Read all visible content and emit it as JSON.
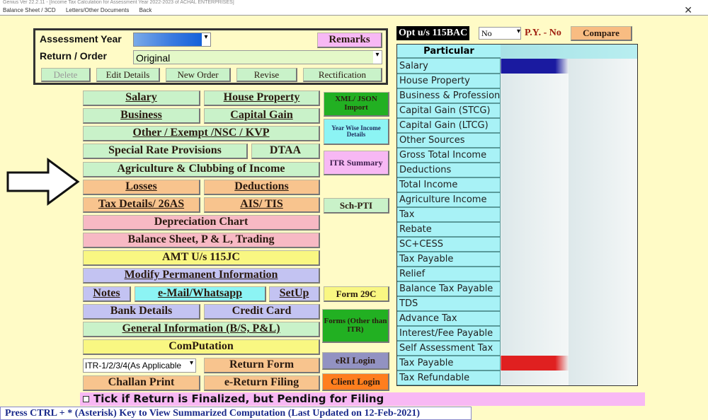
{
  "window": {
    "title": "Genius Ver 22.2.11 - [Income Tax Calculation for Assessment Year 2022-2023 of ACHAL ENTERPRISES]",
    "close": "✕"
  },
  "menu": [
    "Balance Sheet / 3CD",
    "Letters/Other Documents",
    "Back"
  ],
  "panel": {
    "assessment_year_label": "Assessment Year",
    "return_order_label": "Return / Order",
    "return_order_value": "Original",
    "remarks": "Remarks",
    "actions": [
      "Delete",
      "Edit Details",
      "New Order",
      "Revise",
      "Rectification"
    ]
  },
  "opt": {
    "label": "Opt u/s 115BAC",
    "value": "No",
    "py": "P.Y. - No",
    "compare": "Compare"
  },
  "buttons": {
    "salary": "Salary",
    "house_property": "House Property",
    "business": "Business",
    "capital_gain": "Capital Gain",
    "other": "Other / Exempt /NSC / KVP",
    "special_rate": "Special Rate Provisions",
    "dtaa": "DTAA",
    "agriculture": "Agriculture & Clubbing of Income",
    "losses": "Losses",
    "deductions": "Deductions",
    "tax_details": "Tax Details/ 26AS",
    "ais": "AIS/ TIS",
    "depreciation": "Depreciation Chart",
    "balance_sheet": "Balance Sheet, P & L, Trading",
    "amt": "AMT U/s 115JC",
    "modify": "Modify Permanent Information",
    "notes": "Notes",
    "email": "e-Mail/Whatsapp",
    "setup": "SetUp",
    "bank": "Bank Details",
    "credit_card": "Credit Card",
    "general": "General Information (B/S, P&L)",
    "computation": "ComPutation",
    "itr_select": "ITR-1/2/3/4(As Applicable",
    "return_form": "Return Form",
    "challan": "Challan Print",
    "e_return": "e-Return Filing"
  },
  "side": {
    "xml": "XML/ JSON Import",
    "year_wise": "Year Wise Income Details",
    "itr_summary": "ITR Summary",
    "sch_pti": "Sch-PTI",
    "form29c": "Form 29C",
    "forms_other": "Forms (Other than ITR)",
    "eri": "eRI Login",
    "client": "Client Login"
  },
  "table": {
    "header": "Particular",
    "rows": [
      "Salary",
      "House Property",
      "Business & Profession",
      "Capital Gain (STCG)",
      "Capital Gain (LTCG)",
      "Other Sources",
      "Gross Total Income",
      "Deductions",
      "Total Income",
      "Agriculture Income",
      "Tax",
      "Rebate",
      "SC+CESS",
      "Tax Payable",
      "Relief",
      "Balance Tax Payable",
      "TDS",
      "Advance Tax",
      "Interest/Fee Payable",
      "Self Assessment Tax",
      "Tax Payable",
      "Tax Refundable"
    ]
  },
  "finalized": "Tick if Return is Finalized, but Pending for Filing",
  "status": "Press CTRL + * (Asterisk) Key to View Summarized Computation (Last Updated on 12-Feb-2021)",
  "colors": {
    "background": "#fffbc6",
    "green": "#c9f2c9",
    "orange": "#f8c48e",
    "pink": "#f7b9c4",
    "lavender": "#c3c3f2",
    "table": "#a8f2f6"
  }
}
